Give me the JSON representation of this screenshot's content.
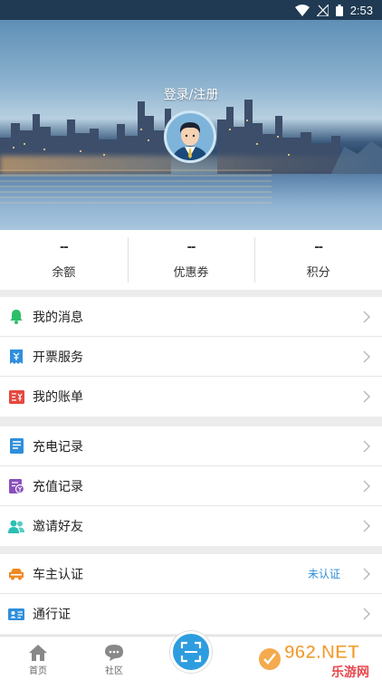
{
  "status_bar": {
    "time": "2:53"
  },
  "header": {
    "login_label": "登录/注册"
  },
  "stats": [
    {
      "value": "--",
      "label": "余额"
    },
    {
      "value": "--",
      "label": "优惠券"
    },
    {
      "value": "--",
      "label": "积分"
    }
  ],
  "menu": {
    "group1": [
      {
        "label": "我的消息",
        "icon": "bell-icon",
        "color": "#2fbf6a"
      },
      {
        "label": "开票服务",
        "icon": "invoice-icon",
        "color": "#2f8fdc"
      },
      {
        "label": "我的账单",
        "icon": "bill-icon",
        "color": "#e5483f"
      }
    ],
    "group2": [
      {
        "label": "充电记录",
        "icon": "charge-record-icon",
        "color": "#2f8fdc"
      },
      {
        "label": "充值记录",
        "icon": "recharge-record-icon",
        "color": "#8a4fbd"
      },
      {
        "label": "邀请好友",
        "icon": "friends-icon",
        "color": "#2bbfb4"
      }
    ],
    "group3": [
      {
        "label": "车主认证",
        "icon": "car-icon",
        "color": "#f08a24",
        "status": "未认证"
      },
      {
        "label": "通行证",
        "icon": "pass-card-icon",
        "color": "#2f8fdc"
      }
    ]
  },
  "tabbar": {
    "home_label": "首页",
    "community_label": "社区"
  },
  "watermark": {
    "text": "962.NET",
    "subtext": "乐游网"
  },
  "colors": {
    "accent": "#2e9de0",
    "status_bar": "#1f3a52"
  }
}
